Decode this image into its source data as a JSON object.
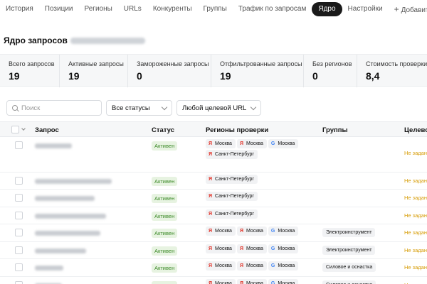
{
  "nav": {
    "items": [
      "История",
      "Позиции",
      "Регионы",
      "URLs",
      "Конкуренты",
      "Группы",
      "Трафик по запросам",
      "Ядро",
      "Настройки"
    ],
    "add_label": "Добавить запросы"
  },
  "page": {
    "title": "Ядро запросов"
  },
  "stats": [
    {
      "label": "Всего запросов",
      "value": "19"
    },
    {
      "label": "Активные запросы",
      "value": "19"
    },
    {
      "label": "Замороженные запросы",
      "value": "0"
    },
    {
      "label": "Отфильтрованные запросы",
      "value": "19"
    },
    {
      "label": "Без регионов",
      "value": "0"
    },
    {
      "label": "Стоимость проверки",
      "value": "8,4"
    }
  ],
  "filters": {
    "search_placeholder": "Поиск",
    "status_value": "Все статусы",
    "url_value": "Любой целевой URL"
  },
  "table": {
    "columns": [
      "Запрос",
      "Статус",
      "Регионы проверки",
      "Группы",
      "Целевой"
    ],
    "rows": [
      {
        "status": "Активен",
        "regions": [
          {
            "engine": "yandex",
            "label": "Москва"
          },
          {
            "engine": "yandex",
            "label": "Москва"
          },
          {
            "engine": "google",
            "label": "Москва"
          },
          {
            "engine": "yandex",
            "label": "Санкт-Петербург"
          }
        ],
        "group": "",
        "target": "Не задан"
      },
      {
        "status": "Активен",
        "regions": [
          {
            "engine": "yandex",
            "label": "Санкт-Петербург"
          }
        ],
        "group": "",
        "target": "Не задан"
      },
      {
        "status": "Активен",
        "regions": [
          {
            "engine": "yandex",
            "label": "Санкт-Петербург"
          }
        ],
        "group": "",
        "target": "Не задан"
      },
      {
        "status": "Активен",
        "regions": [
          {
            "engine": "yandex",
            "label": "Санкт-Петербург"
          }
        ],
        "group": "",
        "target": "Не задан"
      },
      {
        "status": "Активен",
        "regions": [
          {
            "engine": "yandex",
            "label": "Москва"
          },
          {
            "engine": "yandex",
            "label": "Москва"
          },
          {
            "engine": "google",
            "label": "Москва"
          }
        ],
        "group": "Электроинструмент",
        "target": "Не задан"
      },
      {
        "status": "Активен",
        "regions": [
          {
            "engine": "yandex",
            "label": "Москва"
          },
          {
            "engine": "yandex",
            "label": "Москва"
          },
          {
            "engine": "google",
            "label": "Москва"
          }
        ],
        "group": "Электроинструмент",
        "target": "Не задан"
      },
      {
        "status": "Активен",
        "regions": [
          {
            "engine": "yandex",
            "label": "Москва"
          },
          {
            "engine": "yandex",
            "label": "Москва"
          },
          {
            "engine": "google",
            "label": "Москва"
          }
        ],
        "group": "Силовое и оснастка",
        "target": "Не задан"
      },
      {
        "status": "Активен",
        "regions": [
          {
            "engine": "yandex",
            "label": "Москва"
          },
          {
            "engine": "yandex",
            "label": "Москва"
          },
          {
            "engine": "google",
            "label": "Москва"
          }
        ],
        "group": "Силовое и оснастка",
        "target": "Не задан"
      }
    ]
  },
  "icons": {
    "yandex": "Я",
    "google": "G",
    "info": "?",
    "plus": "+"
  },
  "colors": {
    "active_tab": "#1a1a1a",
    "status_green": "#3c8a28",
    "yandex_red": "#e2352a",
    "google_blue": "#4285f4",
    "target_orange": "#d69a00"
  }
}
